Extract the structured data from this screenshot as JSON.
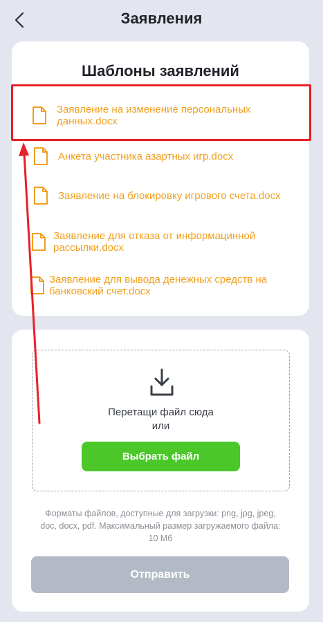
{
  "header": {
    "title": "Заявления",
    "back_icon": "chevron-left-icon"
  },
  "templates": {
    "title": "Шаблоны заявлений",
    "items": [
      {
        "label": "Заявление на изменение персональных данных.docx"
      },
      {
        "label": "Анкета участника азартных игр.docx"
      },
      {
        "label": "Заявление на блокировку игрового счета.docx"
      },
      {
        "label": "Заявление для отказа от информацинной рассылки.docx"
      },
      {
        "label": "Заявление для вывода денежных средств на банковский счет.docx"
      }
    ]
  },
  "upload": {
    "drop_text_line1": "Перетащи файл сюда",
    "drop_text_line2": "или",
    "choose_label": "Выбрать файл",
    "formats_text": "Форматы файлов, доступные для загрузки: png, jpg, jpeg, doc, docx, pdf. Максимальный размер загружаемого файла: 10 Мб",
    "submit_label": "Отправить"
  },
  "colors": {
    "accent": "#f0a020",
    "green": "#4cc72a",
    "highlight": "#e8202a",
    "disabled": "#b3bac5",
    "background": "#e3e6ee"
  }
}
